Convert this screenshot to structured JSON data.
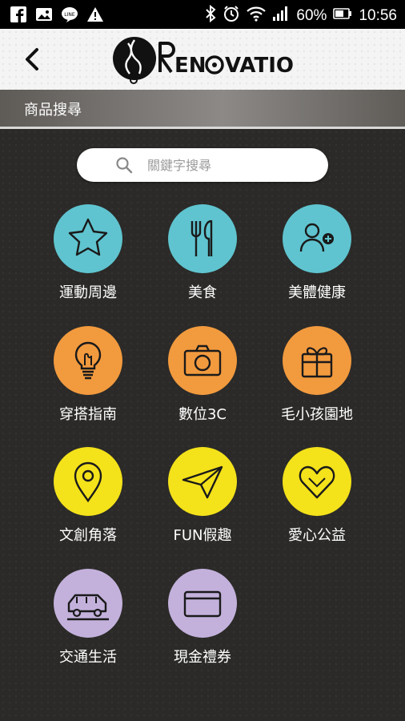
{
  "status_bar": {
    "battery": "60%",
    "time": "10:56",
    "icons": [
      "facebook-icon",
      "gallery-icon",
      "line-icon",
      "warning-icon",
      "bluetooth-icon",
      "alarm-icon",
      "wifi-icon",
      "signal-icon",
      "battery-icon"
    ]
  },
  "header": {
    "logo_text": "RENOVATIO",
    "back_icon": "back-chevron-icon"
  },
  "page": {
    "title": "商品搜尋"
  },
  "search": {
    "placeholder": "關鍵字搜尋",
    "icon": "search-icon"
  },
  "colors": {
    "teal": "#5fc4cf",
    "orange": "#f29a3e",
    "yellow": "#f4e21a",
    "lavender": "#c3b1dc",
    "background": "#2b2a28"
  },
  "categories": [
    {
      "label": "運動周邊",
      "icon": "star-icon",
      "color": "#5fc4cf"
    },
    {
      "label": "美食",
      "icon": "fork-knife-icon",
      "color": "#5fc4cf"
    },
    {
      "label": "美體健康",
      "icon": "user-add-icon",
      "color": "#5fc4cf"
    },
    {
      "label": "穿搭指南",
      "icon": "lightbulb-icon",
      "color": "#f29a3e"
    },
    {
      "label": "數位3C",
      "icon": "camera-icon",
      "color": "#f29a3e"
    },
    {
      "label": "毛小孩園地",
      "icon": "gift-icon",
      "color": "#f29a3e"
    },
    {
      "label": "文創角落",
      "icon": "location-pin-icon",
      "color": "#f4e21a"
    },
    {
      "label": "FUN假趣",
      "icon": "paper-plane-icon",
      "color": "#f4e21a"
    },
    {
      "label": "愛心公益",
      "icon": "heart-icon",
      "color": "#f4e21a"
    },
    {
      "label": "交通生活",
      "icon": "car-icon",
      "color": "#c3b1dc"
    },
    {
      "label": "現金禮券",
      "icon": "card-icon",
      "color": "#c3b1dc"
    }
  ]
}
